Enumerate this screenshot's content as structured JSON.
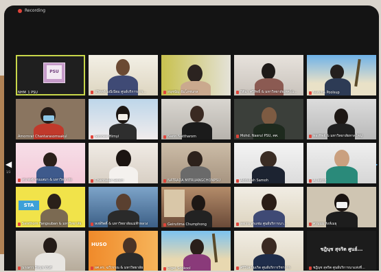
{
  "recording": {
    "label": "Recording"
  },
  "nav": {
    "left_page": "1/3",
    "right_page": "1/3"
  },
  "participants": [
    "NHM_1 PSU",
    "ปกิตตย์ มณีเนียม ศูนย์บริการการ...",
    "อนุชนัญ อัมโภชนกล",
    "กิติมา ศรีสิทธิ์ & มหาวิทยาลัยเทคโน...",
    "Nutcha Poolsup",
    "Amornrat Chantarasomsakul",
    "Sutinee Hirnyi",
    "Narin Nattharom",
    "Mohd. Nasrul PSU, ศศ.",
    "ทองทิพย์ & มหาวิทยาลัยหาดใหญ่",
    "สุรเชษฐ์ พรมเสมา & มหาวิทยาลัย",
    "Chantalak Saisiri",
    "NATRADA MITRUANGCHONPSU",
    "Abdullah Samoh",
    "A..ketrit",
    "Saisthorn Fangsuban & มหาวิทยาลัย",
    "หงษ์กิตติ์ & มหาวิทยาลัยแม่ฟ้าหลวง",
    "Geirutima Chumphong",
    "ลอเรน สุรแช่ม ศูนย์บริการนา...",
    "ศานน่ม สิงห์เมธุ",
    "นางสาว ปิยนุช มั่นดี",
    "ผศ.ดร. ฉวีวรรณ & มหาวิทยาลัย",
    "Rigel Sookool",
    "ศรีวิไล ยิ้มเกิด ศูนย์บริการวิชาการ",
    "ชฎินุช สุจริต ศูนย์บริการนาแห่งที่..."
  ],
  "tile5_center": "ชฎินุช สุจริต  ศูนย์...",
  "logo_text": "PSU",
  "colors": {
    "active_border": "#c9d84a",
    "recording_dot": "#e0443a",
    "mic_muted": "#e0443a"
  }
}
